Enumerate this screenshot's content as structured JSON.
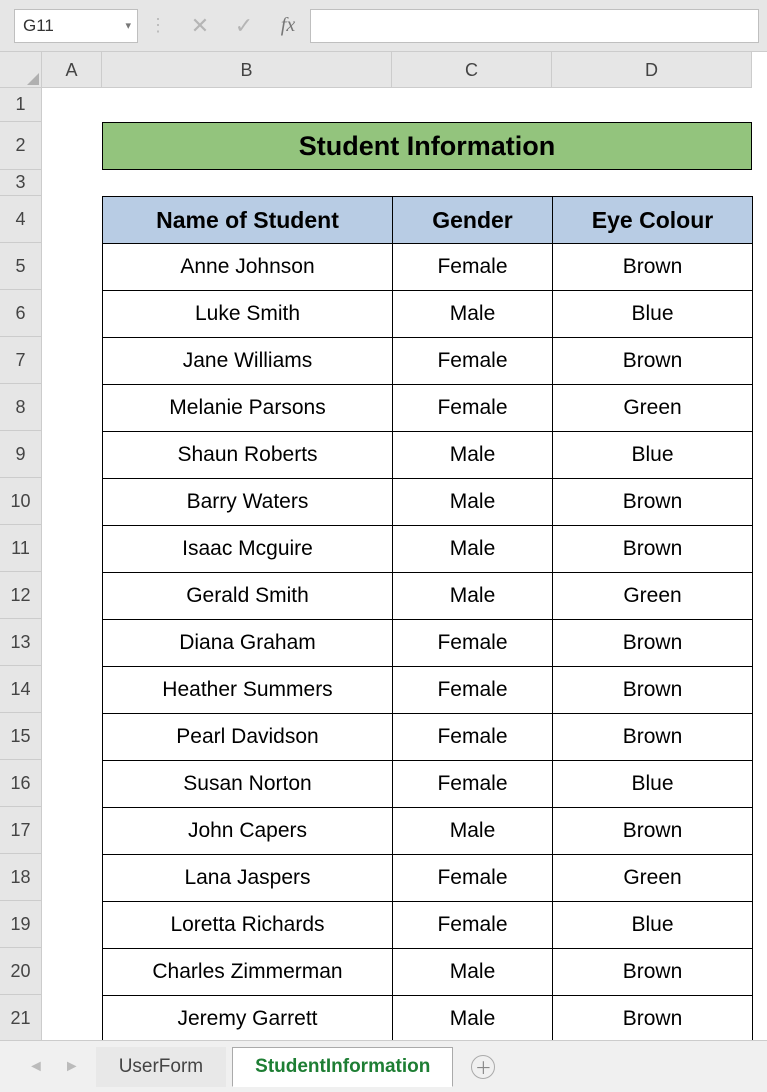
{
  "nameBox": "G11",
  "formulaValue": "",
  "columns": [
    "A",
    "B",
    "C",
    "D"
  ],
  "rowNumbers": [
    "1",
    "2",
    "3",
    "4",
    "5",
    "6",
    "7",
    "8",
    "9",
    "10",
    "11",
    "12",
    "13",
    "14",
    "15",
    "16",
    "17",
    "18",
    "19",
    "20",
    "21"
  ],
  "title": "Student Information",
  "headers": {
    "name": "Name of Student",
    "gender": "Gender",
    "eye": "Eye Colour"
  },
  "students": [
    {
      "name": "Anne Johnson",
      "gender": "Female",
      "eye": "Brown"
    },
    {
      "name": "Luke Smith",
      "gender": "Male",
      "eye": "Blue"
    },
    {
      "name": "Jane Williams",
      "gender": "Female",
      "eye": "Brown"
    },
    {
      "name": "Melanie Parsons",
      "gender": "Female",
      "eye": "Green"
    },
    {
      "name": "Shaun Roberts",
      "gender": "Male",
      "eye": "Blue"
    },
    {
      "name": "Barry Waters",
      "gender": "Male",
      "eye": "Brown"
    },
    {
      "name": "Isaac Mcguire",
      "gender": "Male",
      "eye": "Brown"
    },
    {
      "name": "Gerald Smith",
      "gender": "Male",
      "eye": "Green"
    },
    {
      "name": "Diana Graham",
      "gender": "Female",
      "eye": "Brown"
    },
    {
      "name": "Heather Summers",
      "gender": "Female",
      "eye": "Brown"
    },
    {
      "name": "Pearl Davidson",
      "gender": "Female",
      "eye": "Brown"
    },
    {
      "name": "Susan Norton",
      "gender": "Female",
      "eye": "Blue"
    },
    {
      "name": "John Capers",
      "gender": "Male",
      "eye": "Brown"
    },
    {
      "name": "Lana Jaspers",
      "gender": "Female",
      "eye": "Green"
    },
    {
      "name": "Loretta Richards",
      "gender": "Female",
      "eye": "Blue"
    },
    {
      "name": "Charles Zimmerman",
      "gender": "Male",
      "eye": "Brown"
    },
    {
      "name": "Jeremy Garrett",
      "gender": "Male",
      "eye": "Brown"
    }
  ],
  "tabs": {
    "inactive": "UserForm",
    "active": "StudentInformation"
  },
  "colWidths": {
    "A": 60,
    "B": 290,
    "C": 160,
    "D": 200
  },
  "rowHeights": {
    "1": 34,
    "2": 48,
    "3": 26,
    "default": 47
  }
}
